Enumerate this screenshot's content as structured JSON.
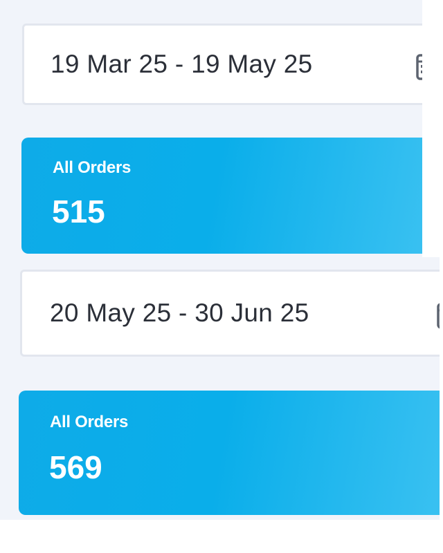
{
  "ranges": [
    {
      "date_range": "19 Mar 25 - 19 May 25",
      "stat": {
        "label": "All Orders",
        "value": "515"
      }
    },
    {
      "date_range": "20 May 25 - 30 Jun 25",
      "stat": {
        "label": "All Orders",
        "value": "569"
      }
    }
  ],
  "icons": {
    "date_picker": "calendar-icon"
  },
  "colors": {
    "background": "#f1f4fa",
    "card_start": "#0eabe8",
    "card_end": "#3fc3f2",
    "field_border": "#e2e6ee",
    "date_text": "#2b2f38"
  }
}
